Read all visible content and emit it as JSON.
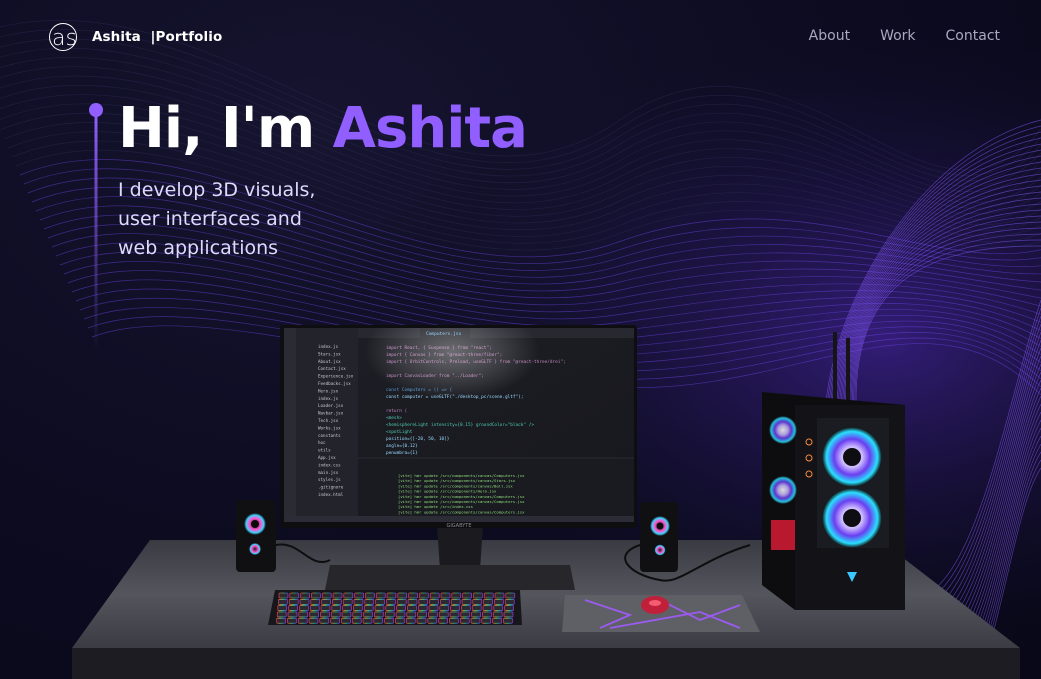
{
  "brand": {
    "logo_letters": "as",
    "name": "Ashita",
    "suffix": "|Portfolio"
  },
  "nav": {
    "links": [
      {
        "label": "About"
      },
      {
        "label": "Work"
      },
      {
        "label": "Contact"
      }
    ]
  },
  "hero": {
    "greeting": "Hi, I'm",
    "name": "Ashita",
    "subtitle_lines": [
      "I develop 3D visuals,",
      "user interfaces and",
      "web applications"
    ]
  },
  "scene": {
    "monitor_brand": "GIGABYTE",
    "editor_filename": "Computers.jsx",
    "code_lines": [
      "import React, { Suspense } from \"react\";",
      "import { Canvas } from \"@react-three/fiber\";",
      "import { OrbitControls, Preload, useGLTF } from \"@react-three/drei\";",
      "import CanvasLoader from \"../Loader\";",
      "const Computers = () => {",
      "  const computer = useGLTF(\"./desktop_pc/scene.gltf\");",
      "  return (",
      "    <mesh>",
      "      <hemisphereLight intensity={0.15} groundColor=\"black\" />",
      "      <spotLight",
      "        position={[-20, 50, 10]}",
      "        angle={0.12}",
      "        penumbra={1}"
    ],
    "sidebar_files": [
      "index.js",
      "Stars.jsx",
      "About.jsx",
      "Contact.jsx",
      "Experience.jsx",
      "Feedbacks.jsx",
      "Hero.jsx",
      "index.js",
      "Loader.jsx",
      "Navbar.jsx",
      "Tech.jsx",
      "Works.jsx",
      "constants",
      "hoc",
      "utils",
      "App.jsx",
      "index.css",
      "main.jsx",
      "styles.js",
      ".gitignore",
      "index.html"
    ],
    "terminal_lines": [
      "[vite] hmr update /src/components/canvas/Computers.jsx",
      "[vite] hmr update /src/components/canvas/Stars.jsx",
      "[vite] hmr update /src/components/canvas/Ball.jsx",
      "[vite] hmr update /src/components/Hero.jsx",
      "[vite] hmr update /src/components/canvas/Computers.jsx",
      "[vite] hmr update /src/components/canvas/Computers.jsx",
      "[vite] hmr update /src/index.css",
      "[vite] hmr update /src/components/canvas/Computers.jsx"
    ]
  },
  "colors": {
    "accent": "#915eff",
    "background": "#0b0a1e",
    "subtitle": "#dfd9ff",
    "nav_link": "#a9a8c2"
  }
}
